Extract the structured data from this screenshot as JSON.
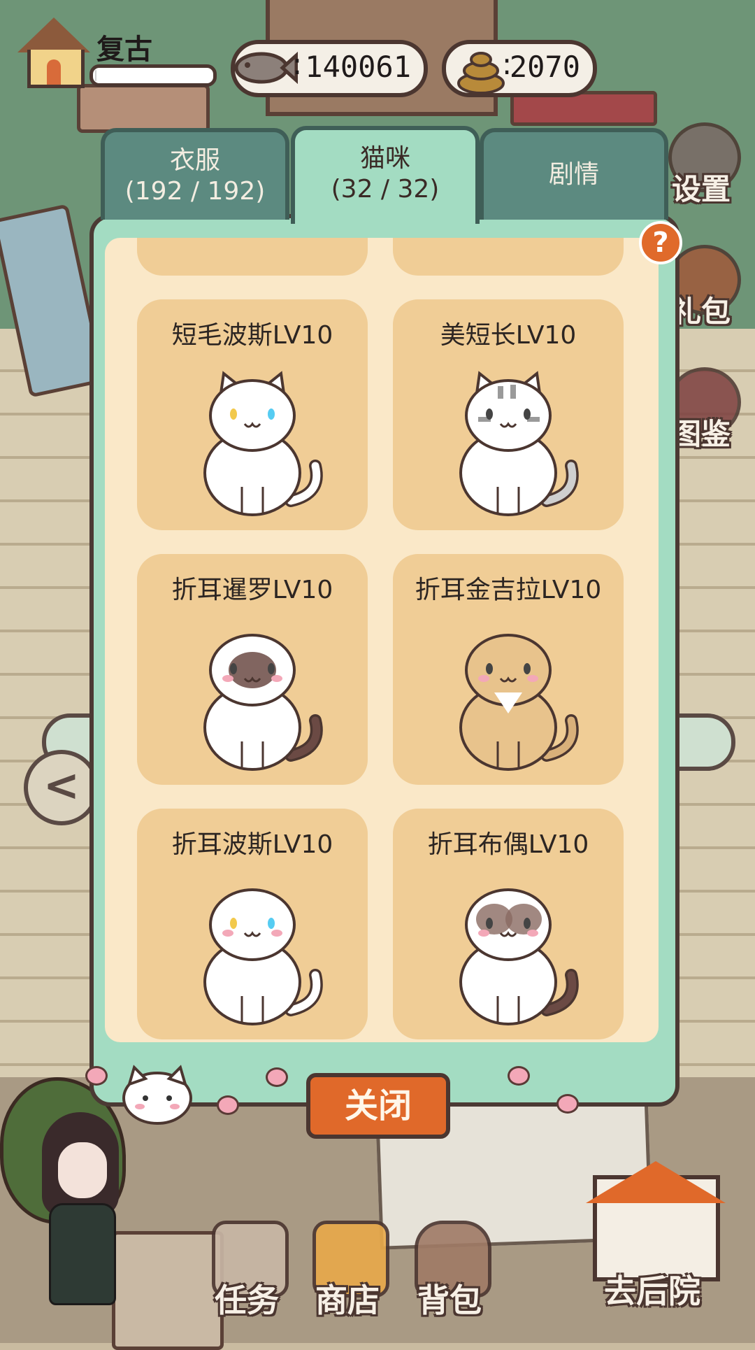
{
  "player": {
    "name": "复古",
    "exp_progress": 0.0
  },
  "currencies": {
    "fish": {
      "icon": "fish-icon",
      "value": "140061"
    },
    "poop": {
      "icon": "poop-icon",
      "value": "2070"
    }
  },
  "tabs": [
    {
      "label": "衣服",
      "count": "(192 / 192)",
      "active": false
    },
    {
      "label": "猫咪",
      "count": "(32 / 32)",
      "active": true
    },
    {
      "label": "剧情",
      "count": "",
      "active": false
    }
  ],
  "side_buttons": {
    "settings": {
      "label": "设置",
      "icon": "gear-icon"
    },
    "gift": {
      "label": "礼包",
      "icon": "gift-icon"
    },
    "catalog": {
      "label": "图鉴",
      "icon": "book-icon"
    }
  },
  "help_label": "?",
  "cats": [
    {
      "name": "短毛波斯LV10",
      "type": "white",
      "eyes": [
        "#f2c94c",
        "#56ccf2"
      ],
      "folded": false,
      "tail": "white"
    },
    {
      "name": "美短长LV10",
      "type": "tabby",
      "eyes": [
        "#444",
        "#444"
      ],
      "folded": false,
      "tail": "tabby"
    },
    {
      "name": "折耳暹罗LV10",
      "type": "siamese",
      "eyes": [
        "#444",
        "#444"
      ],
      "folded": true,
      "tail": "brown"
    },
    {
      "name": "折耳金吉拉LV10",
      "type": "golden",
      "eyes": [
        "#444",
        "#444"
      ],
      "folded": true,
      "tail": "golden"
    },
    {
      "name": "折耳波斯LV10",
      "type": "white",
      "eyes": [
        "#f2c94c",
        "#56ccf2"
      ],
      "folded": true,
      "tail": "white"
    },
    {
      "name": "折耳布偶LV10",
      "type": "ragdoll",
      "eyes": [
        "#444",
        "#444"
      ],
      "folded": true,
      "tail": "brown"
    }
  ],
  "close_label": "关闭",
  "bottom_nav": [
    {
      "label": "任务",
      "icon": "task-icon"
    },
    {
      "label": "商店",
      "icon": "shop-icon"
    },
    {
      "label": "背包",
      "icon": "backpack-icon"
    }
  ],
  "backyard": {
    "label": "去后院",
    "icon": "house-icon"
  },
  "colors": {
    "accent": "#e0692a",
    "modal": "#a3dcc2",
    "card": "#f0cd96",
    "panel": "#fae8c8",
    "outline": "#4b3630"
  }
}
